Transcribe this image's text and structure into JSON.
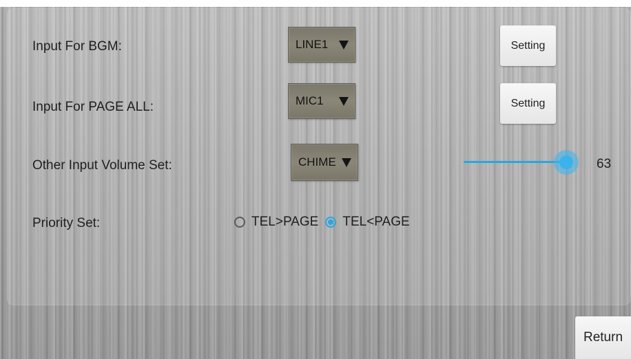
{
  "rows": {
    "bgm": {
      "label": "Input For BGM:",
      "selected": "LINE1",
      "button": "Setting"
    },
    "page_all": {
      "label": "Input For PAGE ALL:",
      "selected": "MIC1",
      "button": "Setting"
    },
    "other_input": {
      "label": "Other Input Volume Set:",
      "selected": "CHIME",
      "volume": "63"
    },
    "priority": {
      "label": "Priority Set:",
      "options": [
        {
          "label": "TEL>PAGE",
          "checked": false
        },
        {
          "label": "TEL<PAGE",
          "checked": true
        }
      ]
    }
  },
  "footer": {
    "return_label": "Return"
  },
  "colors": {
    "accent": "#2aa6e0",
    "dropdown": "#8a8778",
    "button": "#eeeeee"
  },
  "icons": {
    "dropdown_arrow": "triangle-down-icon",
    "radio_unchecked": "radio-unchecked-icon",
    "radio_checked": "radio-checked-icon"
  }
}
